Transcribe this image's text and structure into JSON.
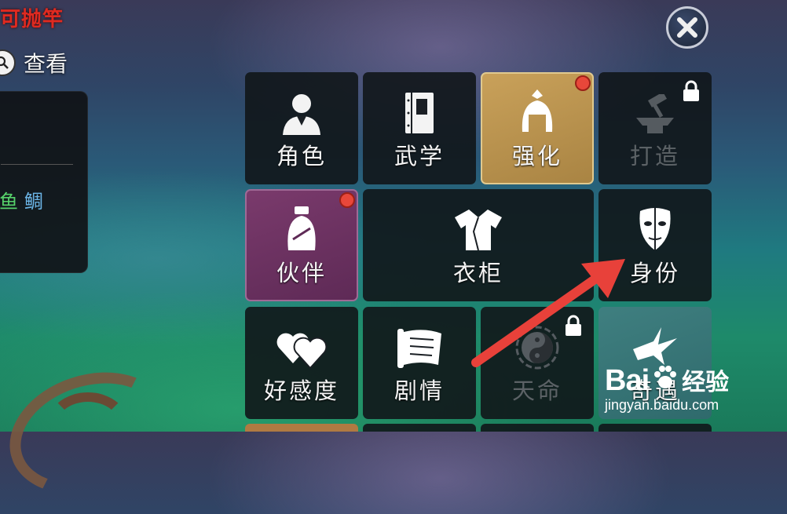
{
  "hud": {
    "top_red_text": "可抛竿",
    "view_label": "查看",
    "fish_1": "鱼",
    "fish_2": "鲷"
  },
  "menu": {
    "tiles": [
      {
        "label": "角色"
      },
      {
        "label": "武学"
      },
      {
        "label": "强化"
      },
      {
        "label": "打造"
      },
      {
        "label": "伙伴"
      },
      {
        "label": "衣柜"
      },
      {
        "label": "身份"
      },
      {
        "label": "好感度"
      },
      {
        "label": "剧情"
      },
      {
        "label": "天命"
      },
      {
        "label": "奇遇"
      }
    ]
  },
  "watermark": {
    "brand": "Bai",
    "brand_cn": "经验",
    "url": "jingyan.baidu.com"
  },
  "colors": {
    "notification_dot": "#e8473a",
    "gold_tile": "#c9a15a",
    "purple_tile": "#7a3a6c",
    "teal_tile": "#3f7f80",
    "arrow": "#e8413a"
  },
  "icons": [
    "search-icon",
    "close-icon",
    "character-icon",
    "book-icon",
    "helmet-icon",
    "anvil-icon",
    "companion-icon",
    "robe-icon",
    "mask-icon",
    "hearts-icon",
    "scroll-icon",
    "yinyang-icon",
    "crane-icon",
    "lock-icon"
  ]
}
